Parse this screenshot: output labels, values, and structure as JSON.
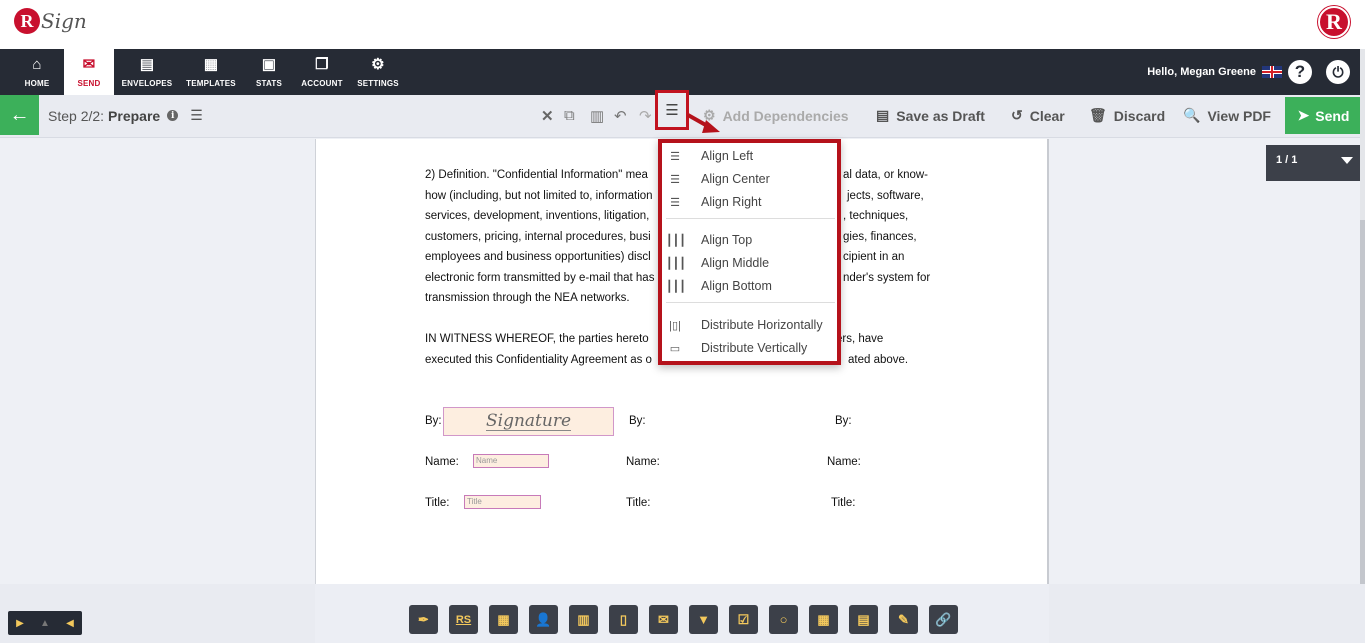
{
  "header": {
    "logo_letter": "R",
    "logo_text": "Sign",
    "logo_right_letter": "R"
  },
  "nav": {
    "items": [
      {
        "label": "HOME",
        "icon": "home-icon"
      },
      {
        "label": "SEND",
        "icon": "envelope-icon"
      },
      {
        "label": "ENVELOPES",
        "icon": "inbox-icon"
      },
      {
        "label": "TEMPLATES",
        "icon": "template-icon"
      },
      {
        "label": "STATS",
        "icon": "briefcase-icon"
      },
      {
        "label": "ACCOUNT",
        "icon": "account-icon"
      },
      {
        "label": "SETTINGS",
        "icon": "gear-icon"
      }
    ],
    "active": "SEND",
    "greeting": "Hello, Megan Greene"
  },
  "toolbar": {
    "step_prefix": "Step 2/2:",
    "step_name": "Prepare",
    "add_dependencies": "Add Dependencies",
    "save_as_draft": "Save as Draft",
    "clear": "Clear",
    "discard": "Discard",
    "view_pdf": "View PDF",
    "send": "Send"
  },
  "align_menu": {
    "items": [
      "Align Left",
      "Align Center",
      "Align Right",
      "Align Top",
      "Align Middle",
      "Align Bottom",
      "Distribute Horizontally",
      "Distribute Vertically"
    ]
  },
  "document": {
    "para1": [
      "2) Definition.  \"Confidential Information\" mea",
      "how (including, but not limited to, information",
      "services, development, inventions, litigation,",
      "customers, pricing, internal procedures, busi",
      "employees and business opportunities) discl",
      "electronic form transmitted by e-mail that has",
      "transmission through the NEA networks."
    ],
    "para1_right": [
      "al data, or know-",
      "jects, software,",
      ", techniques,",
      "gies, finances,",
      "cipient in an",
      "nder's system for"
    ],
    "para2": [
      "IN WITNESS WHEREOF, the parties hereto",
      "executed this Confidentiality Agreement as o"
    ],
    "para2_right": [
      "ers, have",
      "ated above."
    ],
    "by_label": "By:",
    "name_label": "Name:",
    "title_label": "Title:",
    "signature_placeholder": "Signature",
    "name_placeholder": "Name",
    "title_placeholder": "Title"
  },
  "pager": {
    "value": "1 / 1"
  }
}
